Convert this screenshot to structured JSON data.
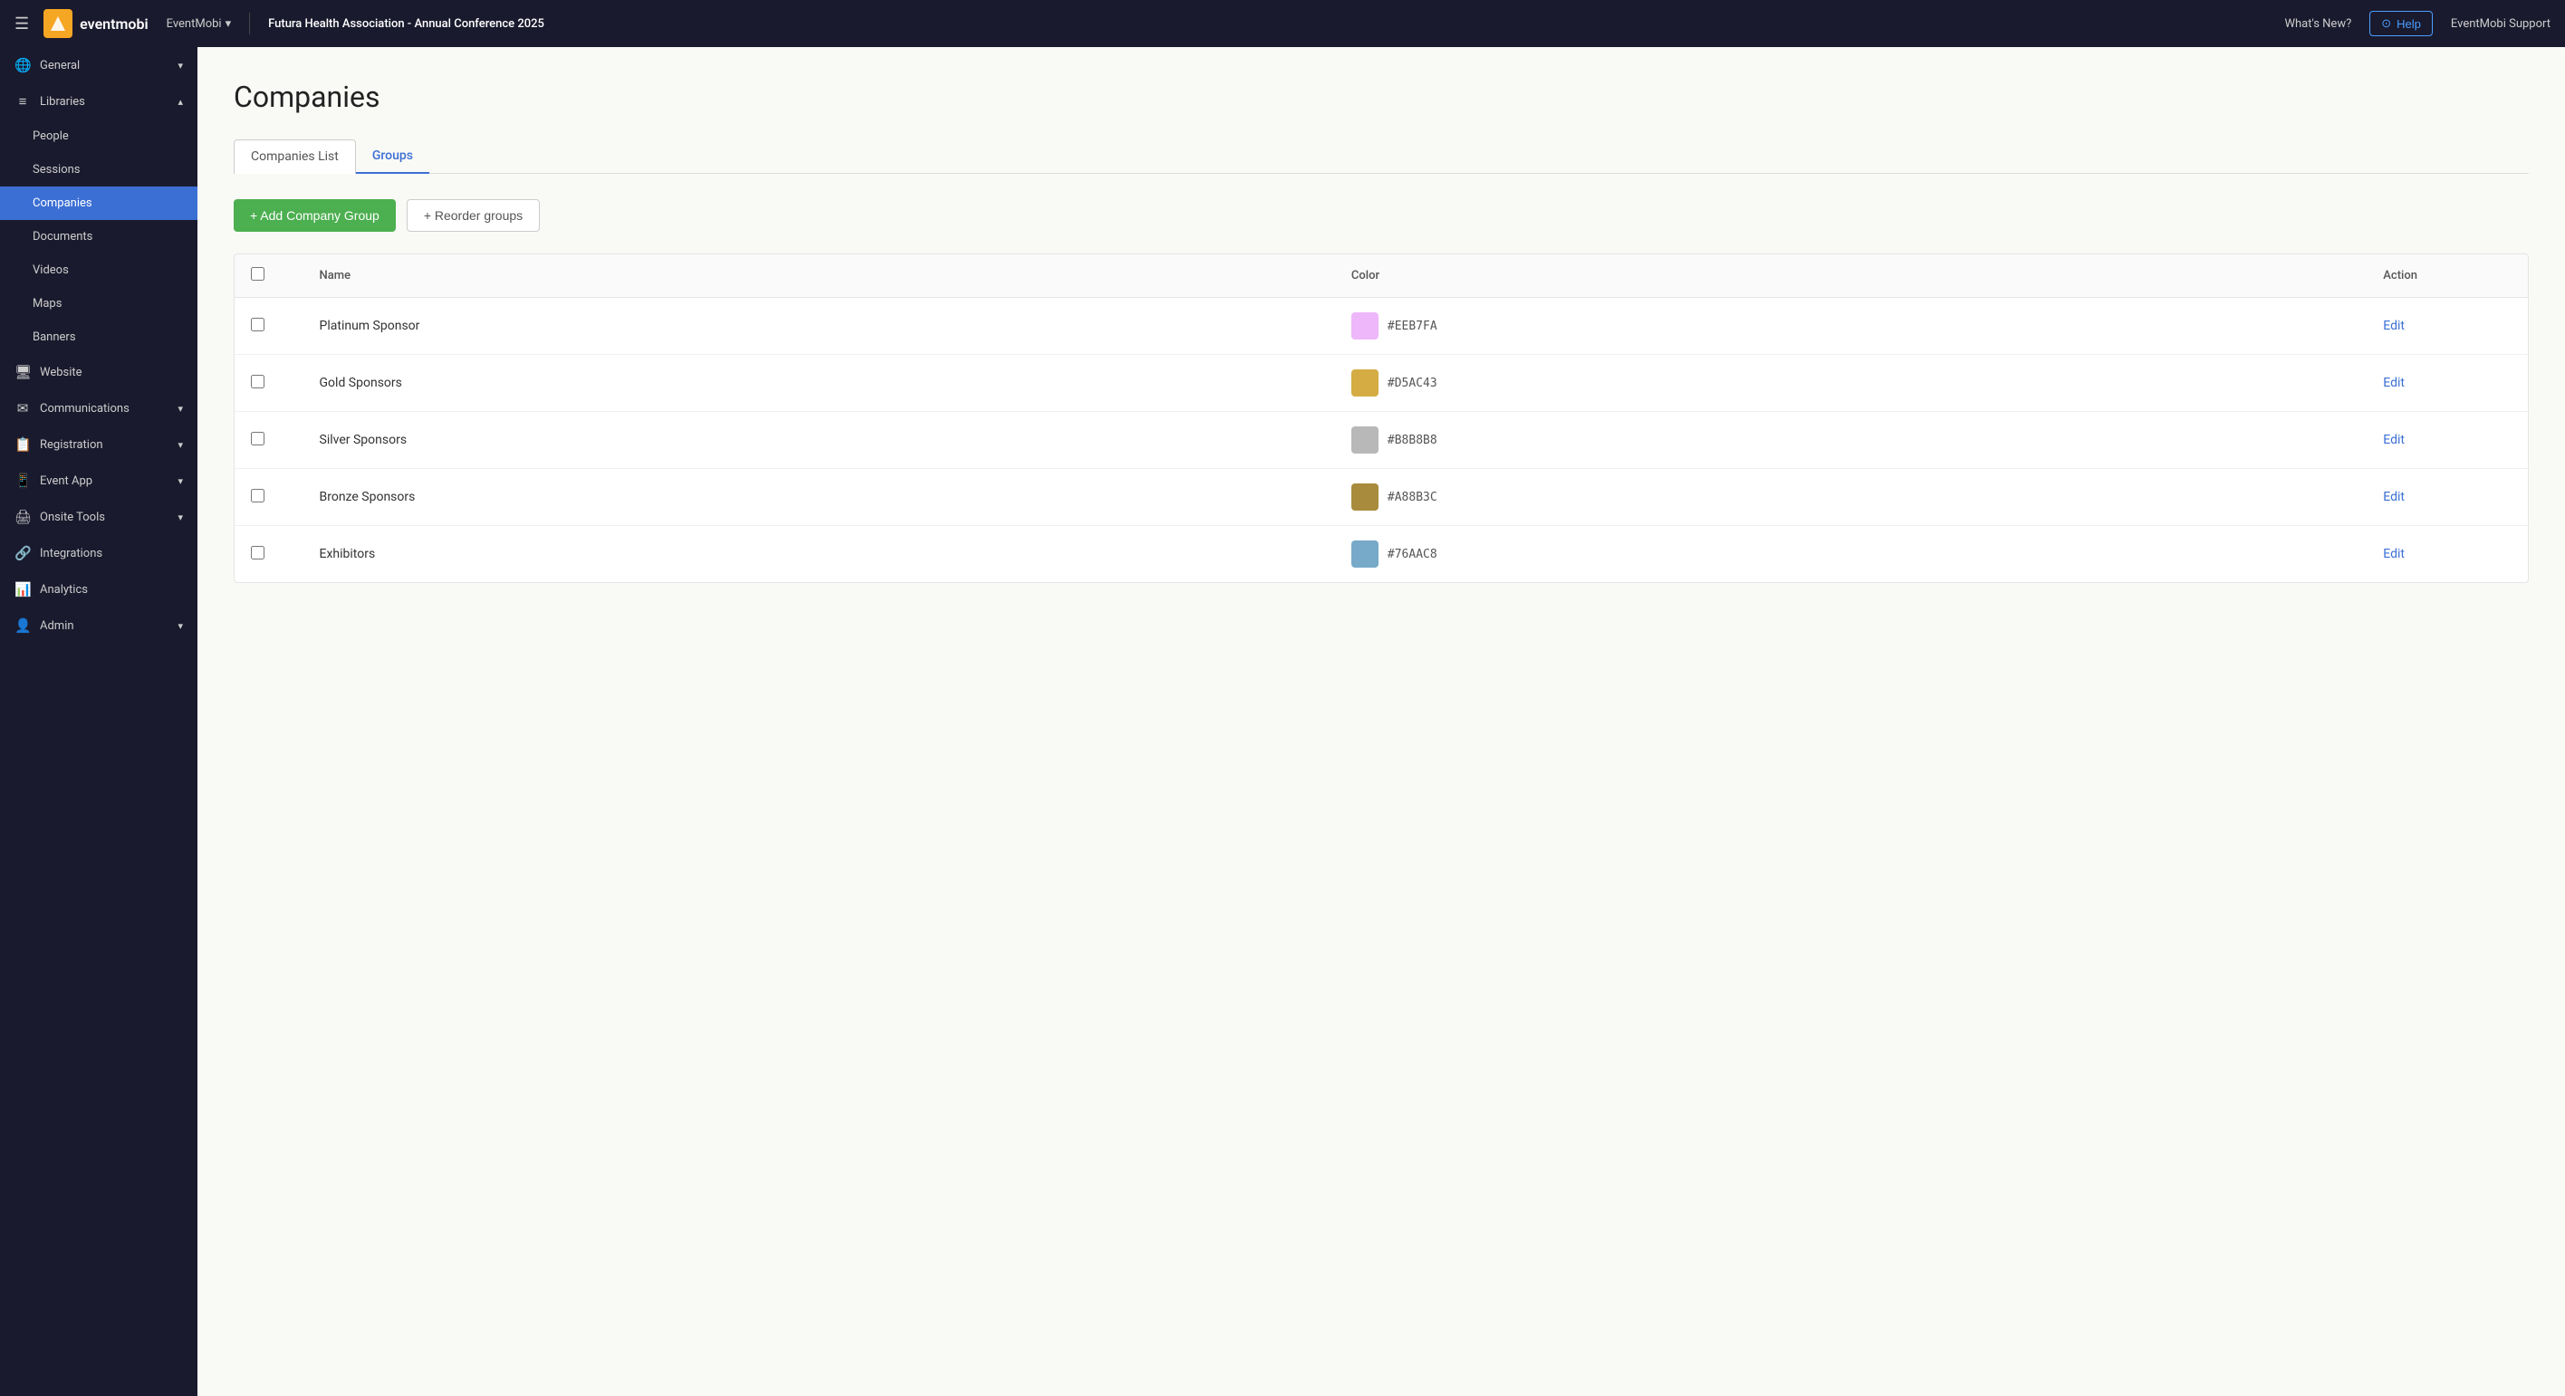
{
  "topnav": {
    "hamburger_icon": "☰",
    "logo_text": "eventmobi",
    "event_selector_label": "EventMobi",
    "event_name": "Futura Health Association - Annual Conference 2025",
    "whats_new_label": "What's New?",
    "help_label": "Help",
    "support_label": "EventMobi Support"
  },
  "sidebar": {
    "sections": [
      {
        "items": [
          {
            "id": "general",
            "label": "General",
            "icon": "🌐",
            "hasChevron": true,
            "active": false,
            "sub": false
          },
          {
            "id": "libraries",
            "label": "Libraries",
            "icon": "☰",
            "hasChevron": true,
            "active": false,
            "sub": false
          },
          {
            "id": "people",
            "label": "People",
            "icon": "",
            "hasChevron": false,
            "active": false,
            "sub": true
          },
          {
            "id": "sessions",
            "label": "Sessions",
            "icon": "",
            "hasChevron": false,
            "active": false,
            "sub": true
          },
          {
            "id": "companies",
            "label": "Companies",
            "icon": "",
            "hasChevron": false,
            "active": true,
            "sub": true
          },
          {
            "id": "documents",
            "label": "Documents",
            "icon": "",
            "hasChevron": false,
            "active": false,
            "sub": true
          },
          {
            "id": "videos",
            "label": "Videos",
            "icon": "",
            "hasChevron": false,
            "active": false,
            "sub": true
          },
          {
            "id": "maps",
            "label": "Maps",
            "icon": "",
            "hasChevron": false,
            "active": false,
            "sub": true
          },
          {
            "id": "banners",
            "label": "Banners",
            "icon": "",
            "hasChevron": false,
            "active": false,
            "sub": true
          },
          {
            "id": "website",
            "label": "Website",
            "icon": "🖥",
            "hasChevron": false,
            "active": false,
            "sub": false
          },
          {
            "id": "communications",
            "label": "Communications",
            "icon": "✉",
            "hasChevron": true,
            "active": false,
            "sub": false
          },
          {
            "id": "registration",
            "label": "Registration",
            "icon": "📋",
            "hasChevron": true,
            "active": false,
            "sub": false
          },
          {
            "id": "event-app",
            "label": "Event App",
            "icon": "📱",
            "hasChevron": true,
            "active": false,
            "sub": false
          },
          {
            "id": "onsite-tools",
            "label": "Onsite Tools",
            "icon": "🖨",
            "hasChevron": true,
            "active": false,
            "sub": false
          },
          {
            "id": "integrations",
            "label": "Integrations",
            "icon": "🔗",
            "hasChevron": false,
            "active": false,
            "sub": false
          },
          {
            "id": "analytics",
            "label": "Analytics",
            "icon": "📊",
            "hasChevron": false,
            "active": false,
            "sub": false
          },
          {
            "id": "admin",
            "label": "Admin",
            "icon": "👤",
            "hasChevron": true,
            "active": false,
            "sub": false
          }
        ]
      }
    ]
  },
  "main": {
    "page_title": "Companies",
    "tabs": [
      {
        "id": "companies-list",
        "label": "Companies List",
        "active": false
      },
      {
        "id": "groups",
        "label": "Groups",
        "active": true
      }
    ],
    "add_group_button": "+ Add Company Group",
    "reorder_button": "+ Reorder groups",
    "table": {
      "columns": [
        {
          "id": "checkbox",
          "label": ""
        },
        {
          "id": "name",
          "label": "Name"
        },
        {
          "id": "color",
          "label": "Color"
        },
        {
          "id": "action",
          "label": "Action"
        }
      ],
      "rows": [
        {
          "id": 1,
          "name": "Platinum Sponsor",
          "color_hex": "#EEB7FA",
          "color_value": "#EEB7FA",
          "action": "Edit"
        },
        {
          "id": 2,
          "name": "Gold Sponsors",
          "color_hex": "#D5AC43",
          "color_value": "#D5AC43",
          "action": "Edit"
        },
        {
          "id": 3,
          "name": "Silver Sponsors",
          "color_hex": "#B8B8B8",
          "color_value": "#B8B8B8",
          "action": "Edit"
        },
        {
          "id": 4,
          "name": "Bronze Sponsors",
          "color_hex": "#A88B3C",
          "color_value": "#A88B3C",
          "action": "Edit"
        },
        {
          "id": 5,
          "name": "Exhibitors",
          "color_hex": "#76AAC8",
          "color_value": "#76AAC8",
          "action": "Edit"
        }
      ]
    }
  },
  "icons": {
    "globe": "🌐",
    "menu": "≡",
    "monitor": "🖥",
    "mail": "✉",
    "clipboard": "📋",
    "phone": "📱",
    "printer": "🖨",
    "link": "🔗",
    "chart": "📊",
    "person": "👤",
    "question": "?",
    "plus": "+"
  }
}
